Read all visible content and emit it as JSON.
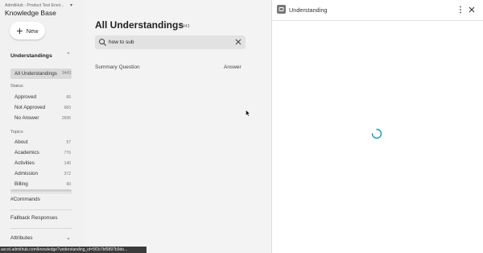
{
  "sidebar": {
    "org_name": "AdmitHub - Product Test Envir...",
    "title": "Knowledge Base",
    "new_label": "New",
    "understandings_section": "Understandings",
    "selected": {
      "label": "All Understandings",
      "count": "3443"
    },
    "status_label": "Status",
    "status_items": [
      {
        "label": "Approved",
        "count": "66"
      },
      {
        "label": "Not Approved",
        "count": "683"
      },
      {
        "label": "No Answer",
        "count": "2695"
      }
    ],
    "topics_label": "Topics",
    "topic_items": [
      {
        "label": "About",
        "count": "57"
      },
      {
        "label": "Academics",
        "count": "776"
      },
      {
        "label": "Activities",
        "count": "146"
      },
      {
        "label": "Admission",
        "count": "372"
      },
      {
        "label": "Billing",
        "count": "90"
      }
    ],
    "commands": "#Commands",
    "fallback": "Fallback Responses",
    "attributes": "Attributes"
  },
  "status_url": "ascot.admithub.com/knowledge?understanding_id=5f1b7bf9897b9de...",
  "main": {
    "title": "All Understandings",
    "count": "3443",
    "search_value": "how to sub",
    "columns": [
      "Summary Question",
      "Answer"
    ]
  },
  "panel": {
    "title": "Understanding"
  },
  "colors": {
    "spinner": "#1a9bb5",
    "sidebar_bg": "#f1f1f1",
    "main_bg": "#f3f3f3"
  }
}
